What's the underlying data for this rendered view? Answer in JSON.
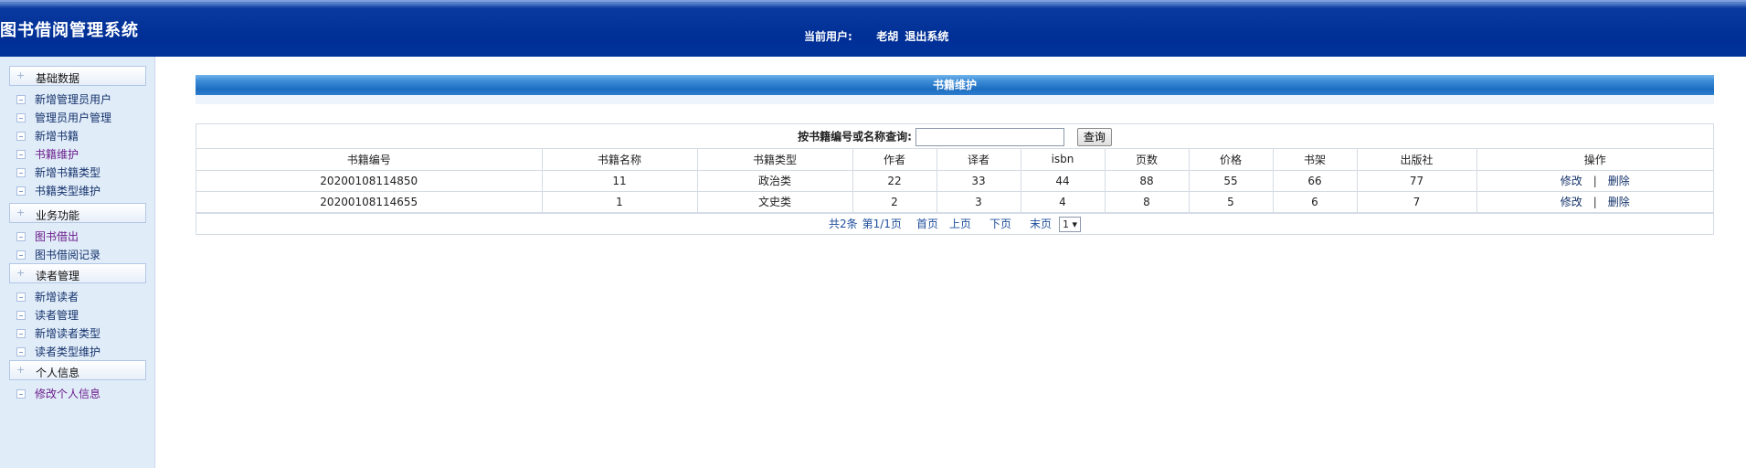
{
  "app": {
    "title": "图书借阅管理系统"
  },
  "userbar": {
    "label": "当前用户:",
    "username": "老胡",
    "logout": "退出系统"
  },
  "sidebar": {
    "groups": [
      {
        "title": "基础数据",
        "items": [
          "新增管理员用户",
          "管理员用户管理",
          "新增书籍",
          "书籍维护",
          "新增书籍类型",
          "书籍类型维护"
        ]
      },
      {
        "title": "业务功能",
        "items": [
          "图书借出",
          "图书借阅记录"
        ]
      },
      {
        "title": "读者管理",
        "items": [
          "新增读者",
          "读者管理",
          "新增读者类型",
          "读者类型维护"
        ]
      },
      {
        "title": "个人信息",
        "items": [
          "修改个人信息"
        ]
      }
    ]
  },
  "panel": {
    "title": "书籍维护"
  },
  "search": {
    "label": "按书籍编号或名称查询:",
    "value": "",
    "button": "查询"
  },
  "table": {
    "headers": [
      "书籍编号",
      "书籍名称",
      "书籍类型",
      "作者",
      "译者",
      "isbn",
      "页数",
      "价格",
      "书架",
      "出版社",
      "操作"
    ],
    "rows": [
      [
        "20200108114850",
        "11",
        "政治类",
        "22",
        "33",
        "44",
        "88",
        "55",
        "66",
        "77"
      ],
      [
        "20200108114655",
        "1",
        "文史类",
        "2",
        "3",
        "4",
        "8",
        "5",
        "6",
        "7"
      ]
    ],
    "edit_label": "修改",
    "delete_label": "删除",
    "separator": "|"
  },
  "pager": {
    "total": "共2条",
    "page": "第1/1页",
    "first": "首页",
    "prev": "上页",
    "next": "下页",
    "last": "末页",
    "select_value": "1 ▾"
  }
}
